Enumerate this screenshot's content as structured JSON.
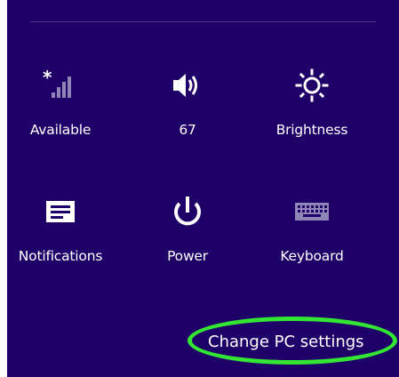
{
  "settings_panel": {
    "tiles": [
      {
        "label": "Available",
        "icon": "network-icon"
      },
      {
        "label": "67",
        "icon": "volume-icon"
      },
      {
        "label": "Brightness",
        "icon": "brightness-icon"
      },
      {
        "label": "Notifications",
        "icon": "notifications-icon"
      },
      {
        "label": "Power",
        "icon": "power-icon"
      },
      {
        "label": "Keyboard",
        "icon": "keyboard-icon"
      }
    ],
    "change_pc_settings_label": "Change PC settings"
  },
  "colors": {
    "panel_background": "#1f0068",
    "highlight_ellipse": "#33e633",
    "text": "#ffffff"
  }
}
